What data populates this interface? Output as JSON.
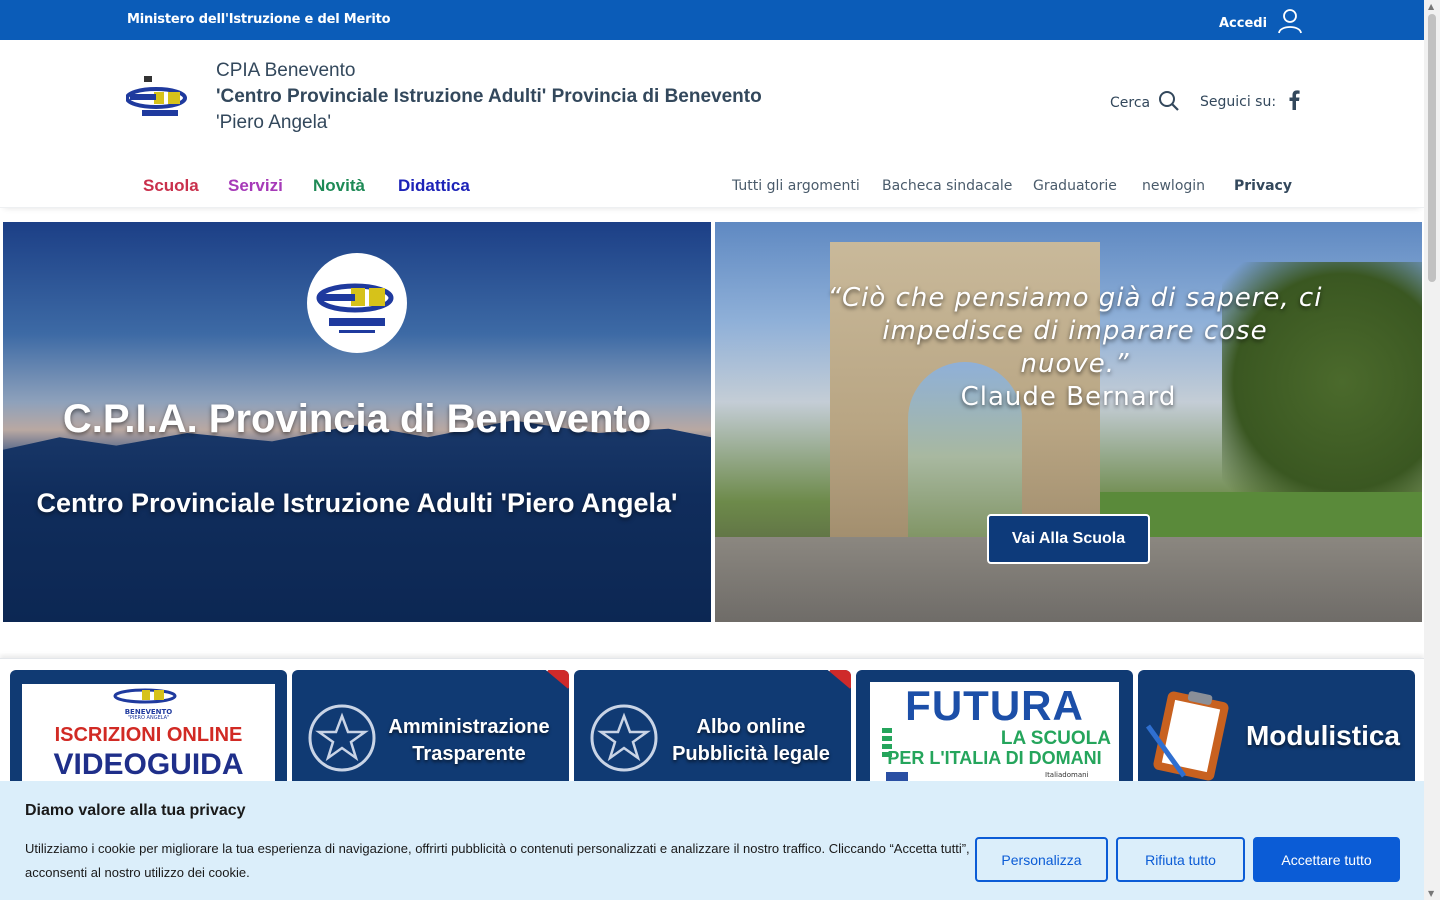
{
  "topbar": {
    "ministry": "Ministero dell'Istruzione e del Merito",
    "login_label": "Accedi"
  },
  "brand": {
    "line1": "CPIA Benevento",
    "line2": "'Centro Provinciale Istruzione Adulti' Provincia di Benevento",
    "line3": "'Piero Angela'"
  },
  "header_tools": {
    "search_label": "Cerca",
    "follow_label": "Seguici su:"
  },
  "nav": {
    "main": [
      {
        "label": "Scuola",
        "color": "#c9304c"
      },
      {
        "label": "Servizi",
        "color": "#a63ab8"
      },
      {
        "label": "Novità",
        "color": "#1e8a56"
      },
      {
        "label": "Didattica",
        "color": "#1d23b8"
      }
    ],
    "secondary": [
      "Tutti gli argomenti",
      "Bacheca sindacale",
      "Graduatorie",
      "newlogin",
      "Privacy"
    ]
  },
  "hero_left": {
    "title": "C.P.I.A. Provincia di Benevento",
    "subtitle": "Centro Provinciale Istruzione Adulti 'Piero Angela'"
  },
  "hero_right": {
    "quote": "“Ciò che pensiamo già di sapere, ci impedisce di imparare cose nuove.”",
    "author": "Claude Bernard",
    "button_label": "Vai Alla Scuola"
  },
  "cards": [
    {
      "line1": "ISCRIZIONI ONLINE",
      "line2": "VIDEOGUIDA",
      "badge": "BENEVENTO",
      "badge2": "\"PIERO ANGELA\""
    },
    {
      "line1": "Amministrazione",
      "line2": "Trasparente"
    },
    {
      "line1": "Albo online",
      "line2": "Pubblicità legale"
    },
    {
      "line1": "FUTURA",
      "line2": "LA SCUOLA",
      "line3": "PER L'ITALIA DI DOMANI",
      "line4": "Italiadomani"
    },
    {
      "line1": "Modulistica"
    }
  ],
  "cookie": {
    "title": "Diamo valore alla tua privacy",
    "text": "Utilizziamo i cookie per migliorare la tua esperienza di navigazione, offrirti pubblicità o contenuti personalizzati e analizzare il nostro traffico. Cliccando “Accetta tutti”, acconsenti al nostro utilizzo dei cookie.",
    "customize": "Personalizza",
    "reject": "Rifiuta tutto",
    "accept": "Accettare tutto"
  },
  "colors": {
    "topbar": "#0b5cb8",
    "primary_button": "#0b5cd6",
    "cookie_bg": "#dbeefa",
    "card_bg": "#103a73"
  }
}
